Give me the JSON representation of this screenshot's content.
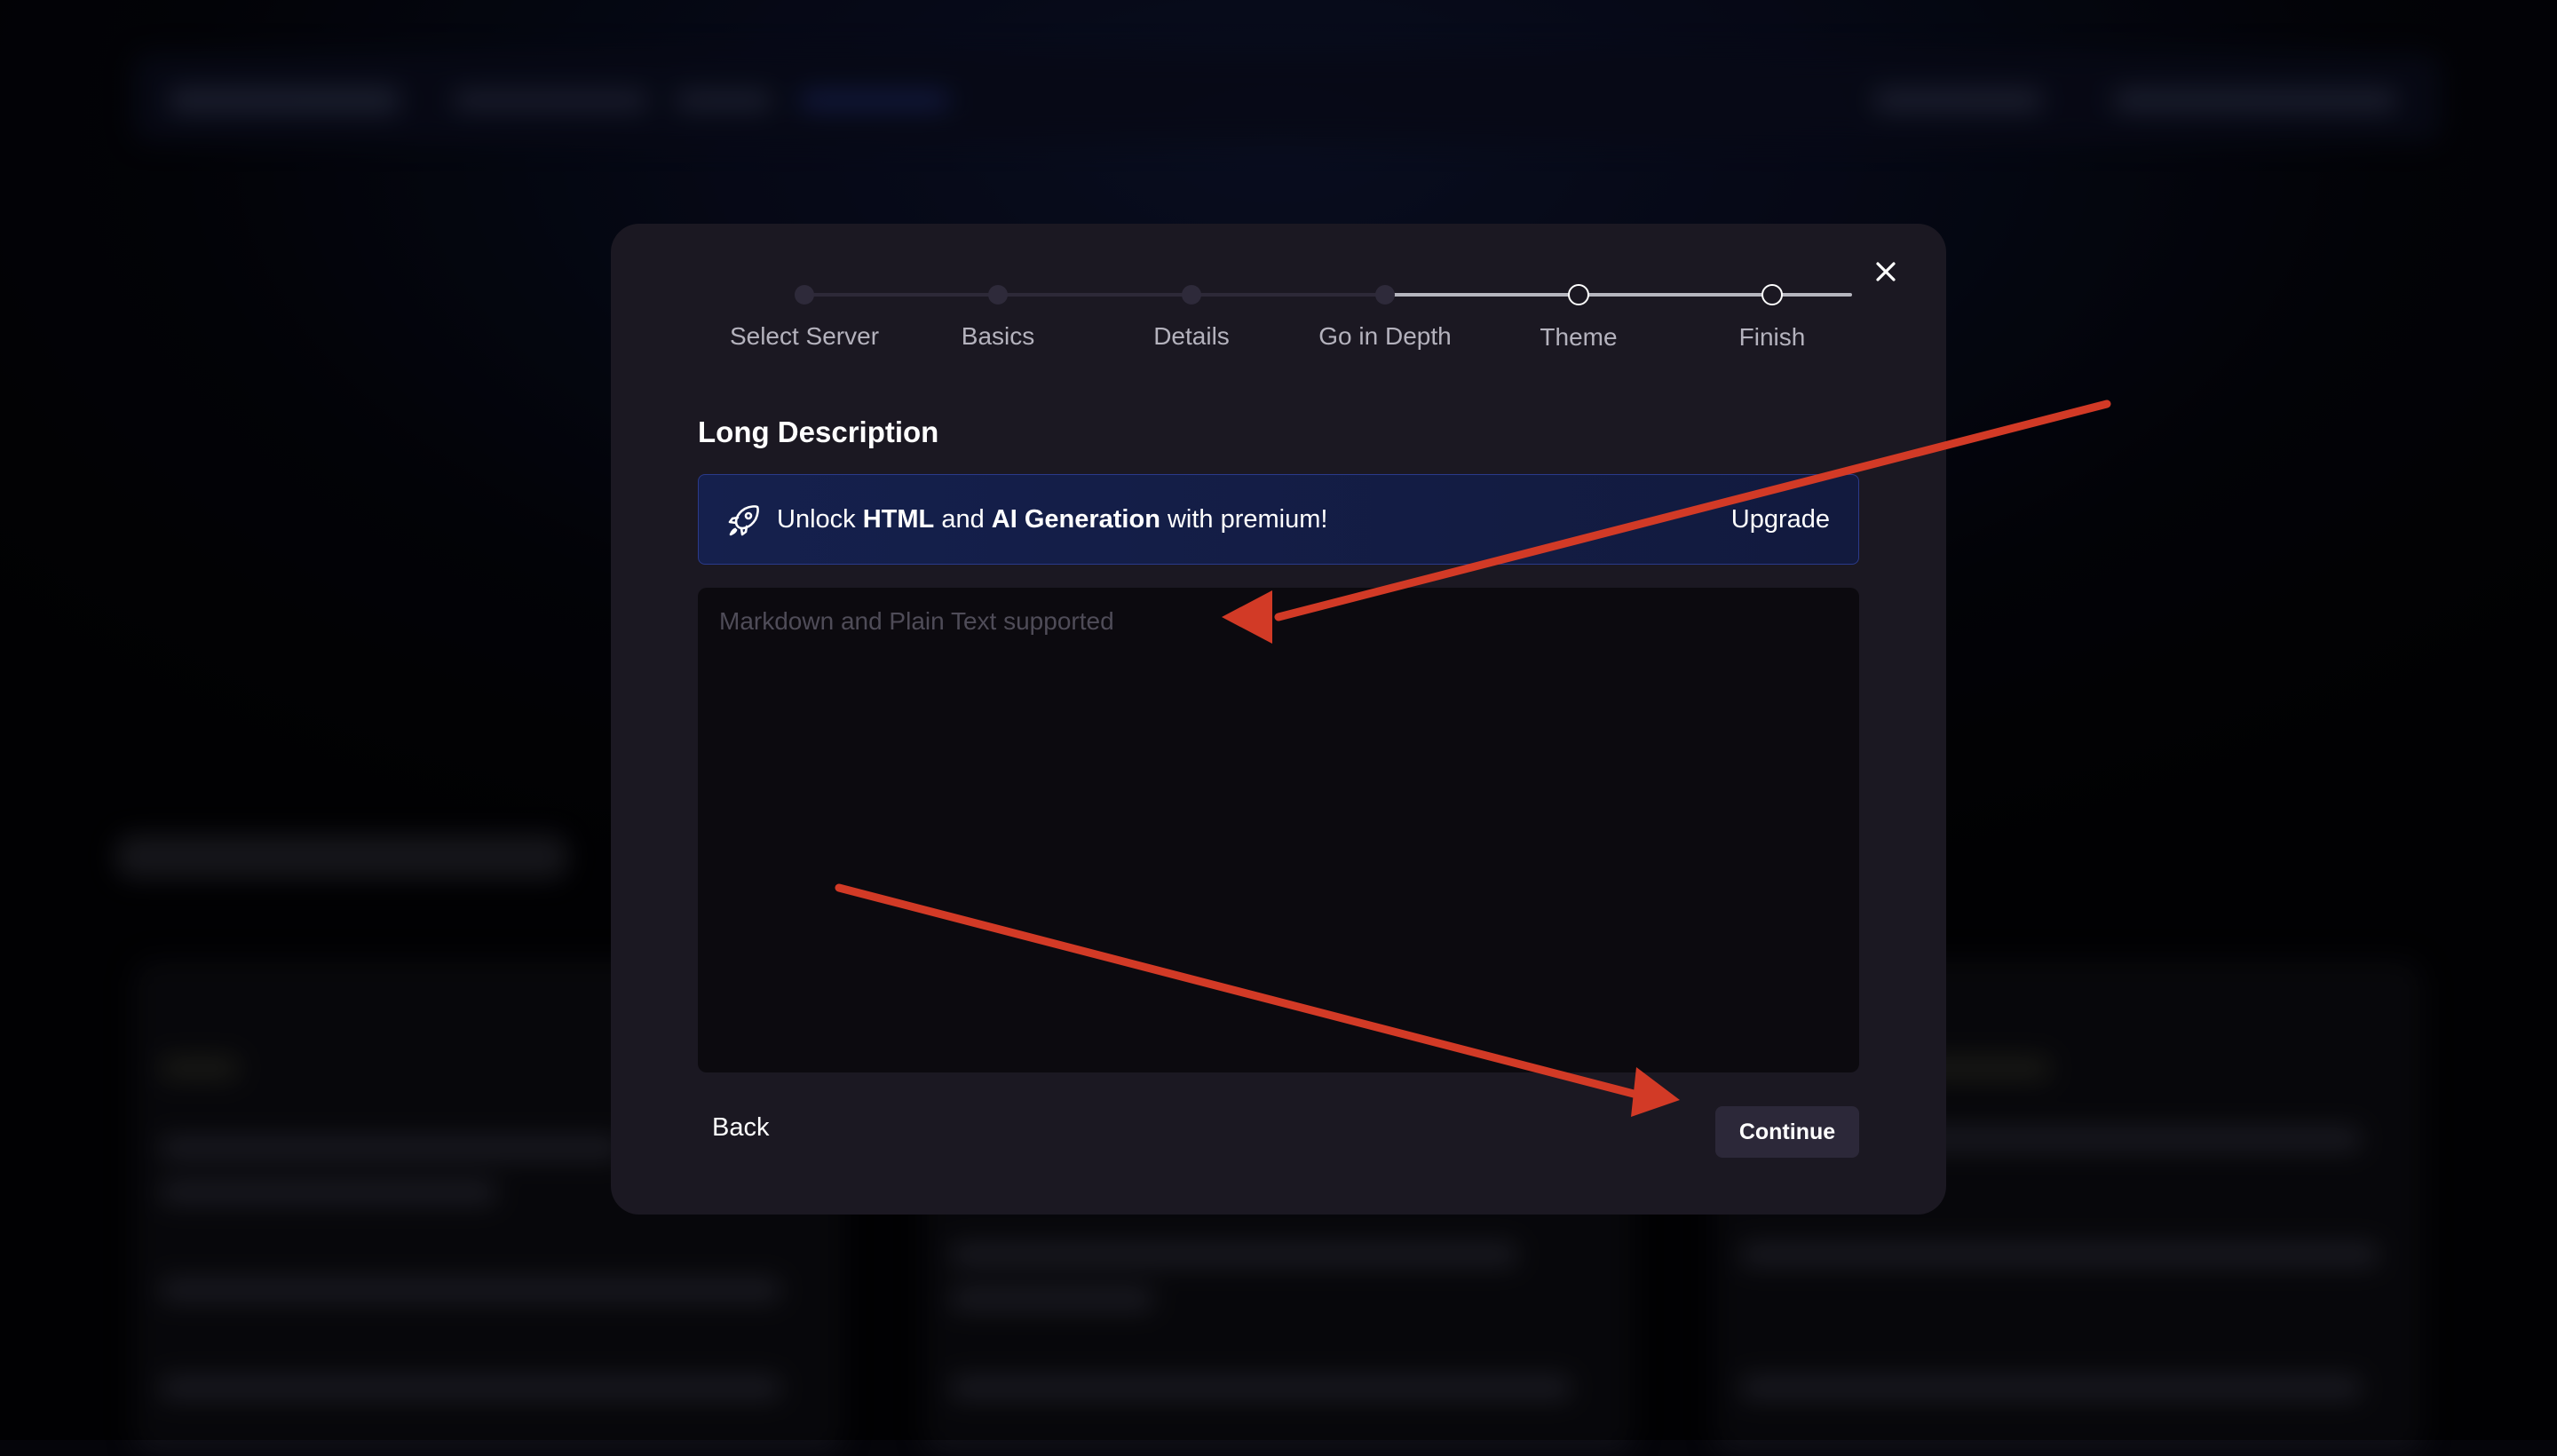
{
  "modal": {
    "close_icon": "close-icon",
    "steps": [
      {
        "label": "Select Server",
        "state": "completed"
      },
      {
        "label": "Basics",
        "state": "completed"
      },
      {
        "label": "Details",
        "state": "completed"
      },
      {
        "label": "Go in Depth",
        "state": "current"
      },
      {
        "label": "Theme",
        "state": "upcoming"
      },
      {
        "label": "Finish",
        "state": "upcoming"
      }
    ],
    "section_title": "Long Description",
    "banner": {
      "icon": "rocket-icon",
      "text_prefix": "Unlock",
      "text_html": "HTML",
      "text_and": "and",
      "text_ai": "AI Generation",
      "text_suffix": "with premium!",
      "upgrade_label": "Upgrade",
      "bg_color": "#15204d",
      "border_color": "#2a3a8a"
    },
    "textarea": {
      "placeholder": "Markdown and Plain Text supported",
      "value": ""
    },
    "back_label": "Back",
    "continue_label": "Continue"
  },
  "annotation_color": "#d23a26"
}
